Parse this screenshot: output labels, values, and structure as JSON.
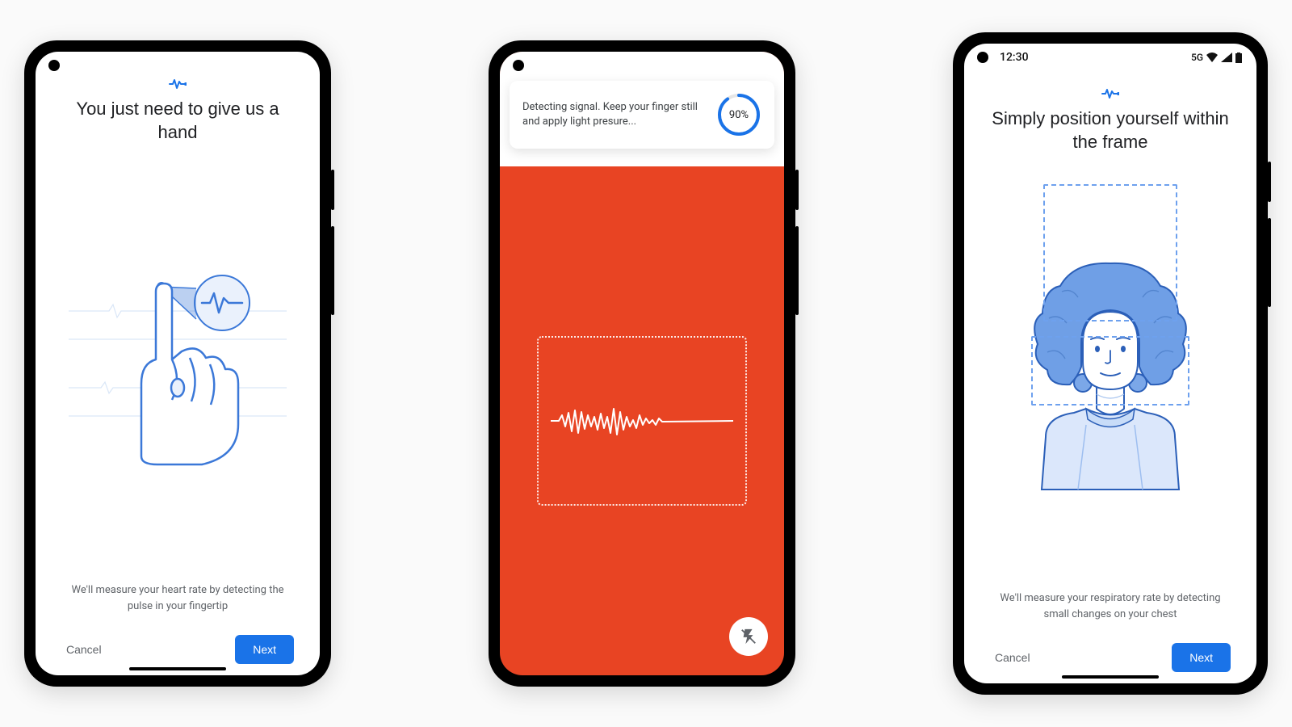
{
  "phone1": {
    "headline": "You just need to give us a hand",
    "subtext": "We'll measure your heart rate by detecting the pulse in your fingertip",
    "cancel": "Cancel",
    "next": "Next"
  },
  "phone2": {
    "card_text": "Detecting signal. Keep your finger still and apply light presure...",
    "progress_label": "90%",
    "progress_value": 90
  },
  "phone3": {
    "status_time": "12:30",
    "status_network": "5G",
    "headline": "Simply position yourself within the frame",
    "subtext": "We'll measure your respiratory rate by detecting small changes on your chest",
    "cancel": "Cancel",
    "next": "Next"
  }
}
